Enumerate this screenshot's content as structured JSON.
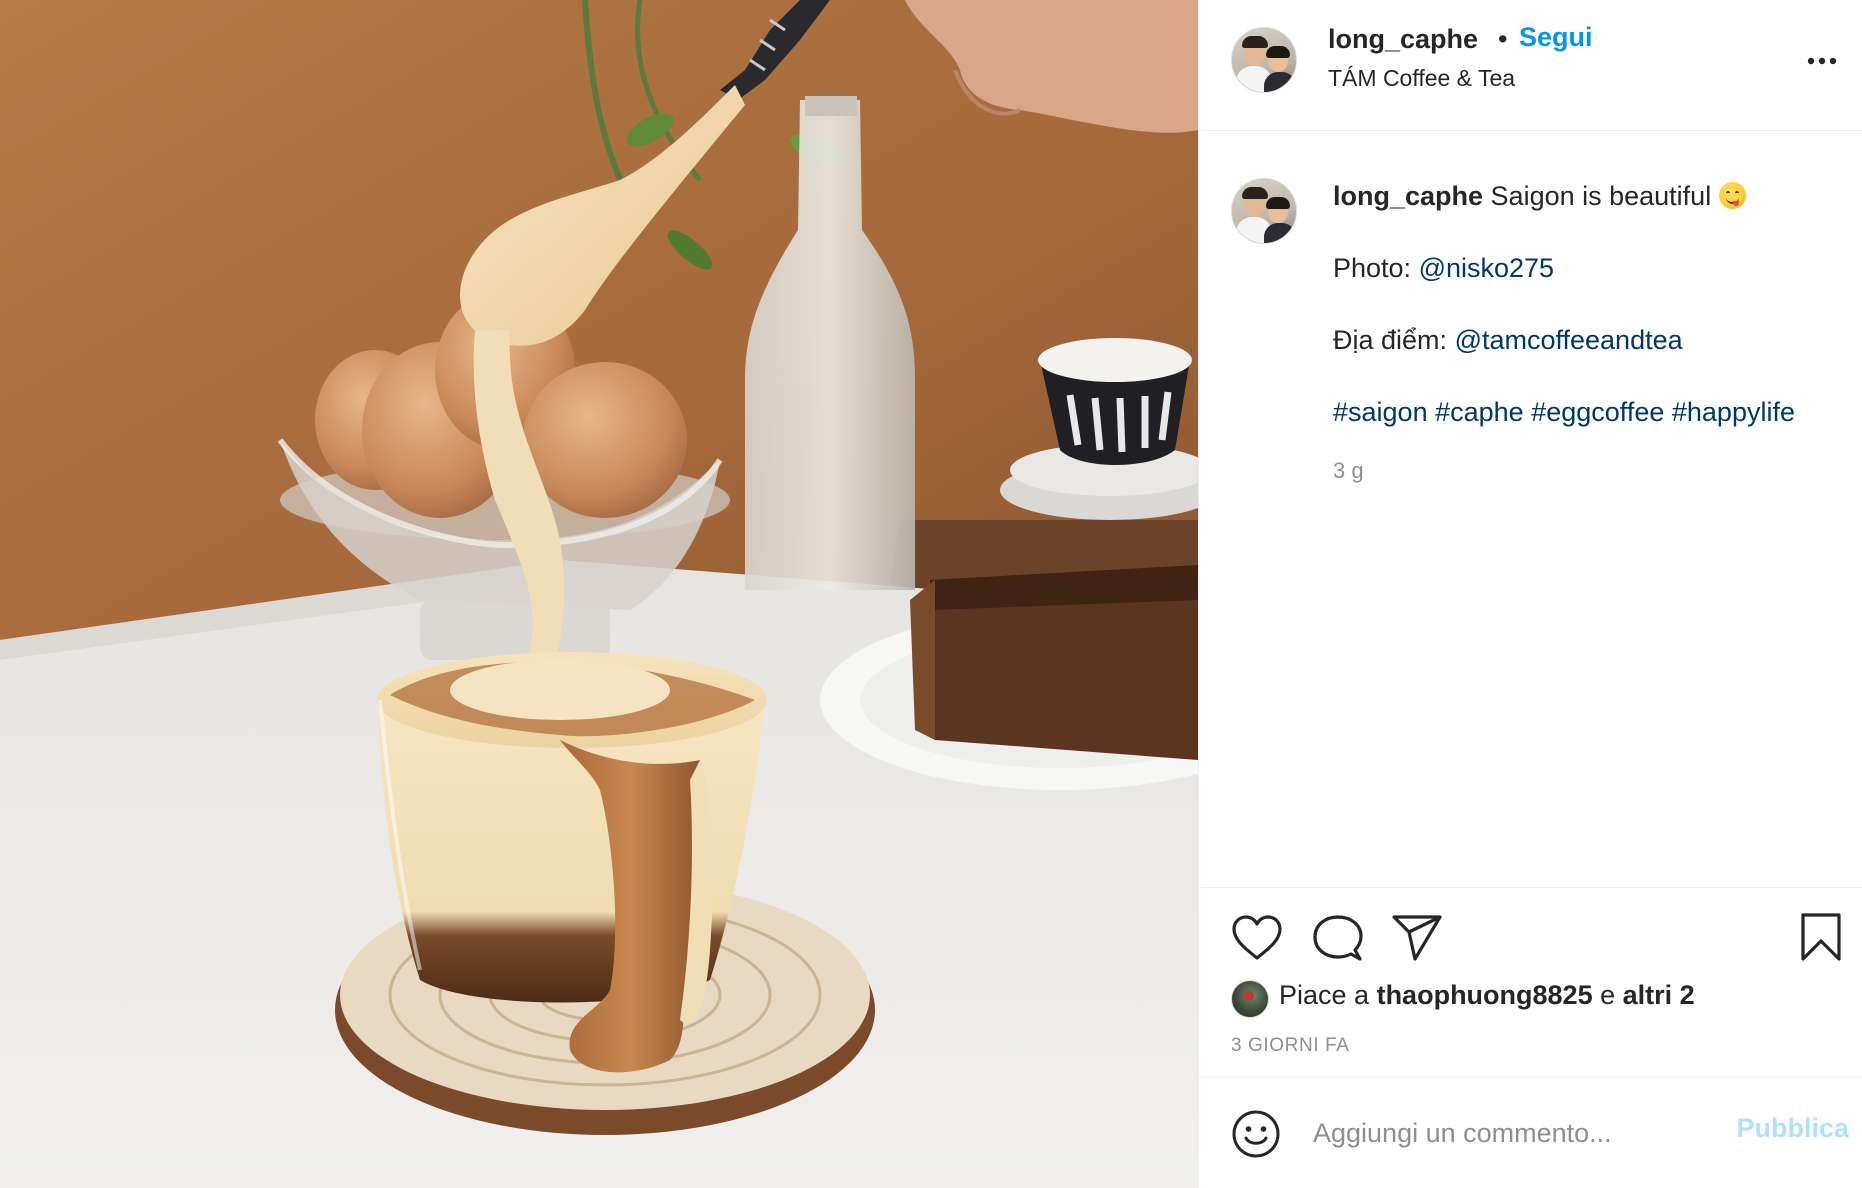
{
  "post": {
    "username": "long_caphe",
    "separator": "•",
    "follow_label": "Segui",
    "location": "TÁM Coffee & Tea",
    "more_icon": "more-horizontal-icon"
  },
  "caption": {
    "username": "long_caphe",
    "text": "Saigon is beautiful",
    "emoji": "yum-face-emoji",
    "photo_label": "Photo:",
    "photo_mention": "@nisko275",
    "place_label": "Địa điểm:",
    "place_mention": "@tamcoffeeandtea",
    "hashtags": [
      "#saigon",
      "#caphe",
      "#eggcoffee",
      "#happylife"
    ],
    "time": "3 g"
  },
  "actions": {
    "like_icon": "heart-icon",
    "comment_icon": "comment-bubble-icon",
    "share_icon": "paper-plane-icon",
    "save_icon": "bookmark-icon"
  },
  "likes": {
    "prefix": "Piace a",
    "user": "thaophuong8825",
    "middle": "e",
    "others": "altri 2"
  },
  "timestamp": "3 GIORNI FA",
  "comment_box": {
    "placeholder": "Aggiungi un commento...",
    "publish_label": "Pubblica"
  },
  "colors": {
    "link_blue": "#0095f6",
    "mention_blue": "#00376b",
    "publish_disabled": "#b2dffc",
    "muted_text": "#8e8e8e",
    "wall": "#a5693a",
    "table": "#eceae6"
  }
}
